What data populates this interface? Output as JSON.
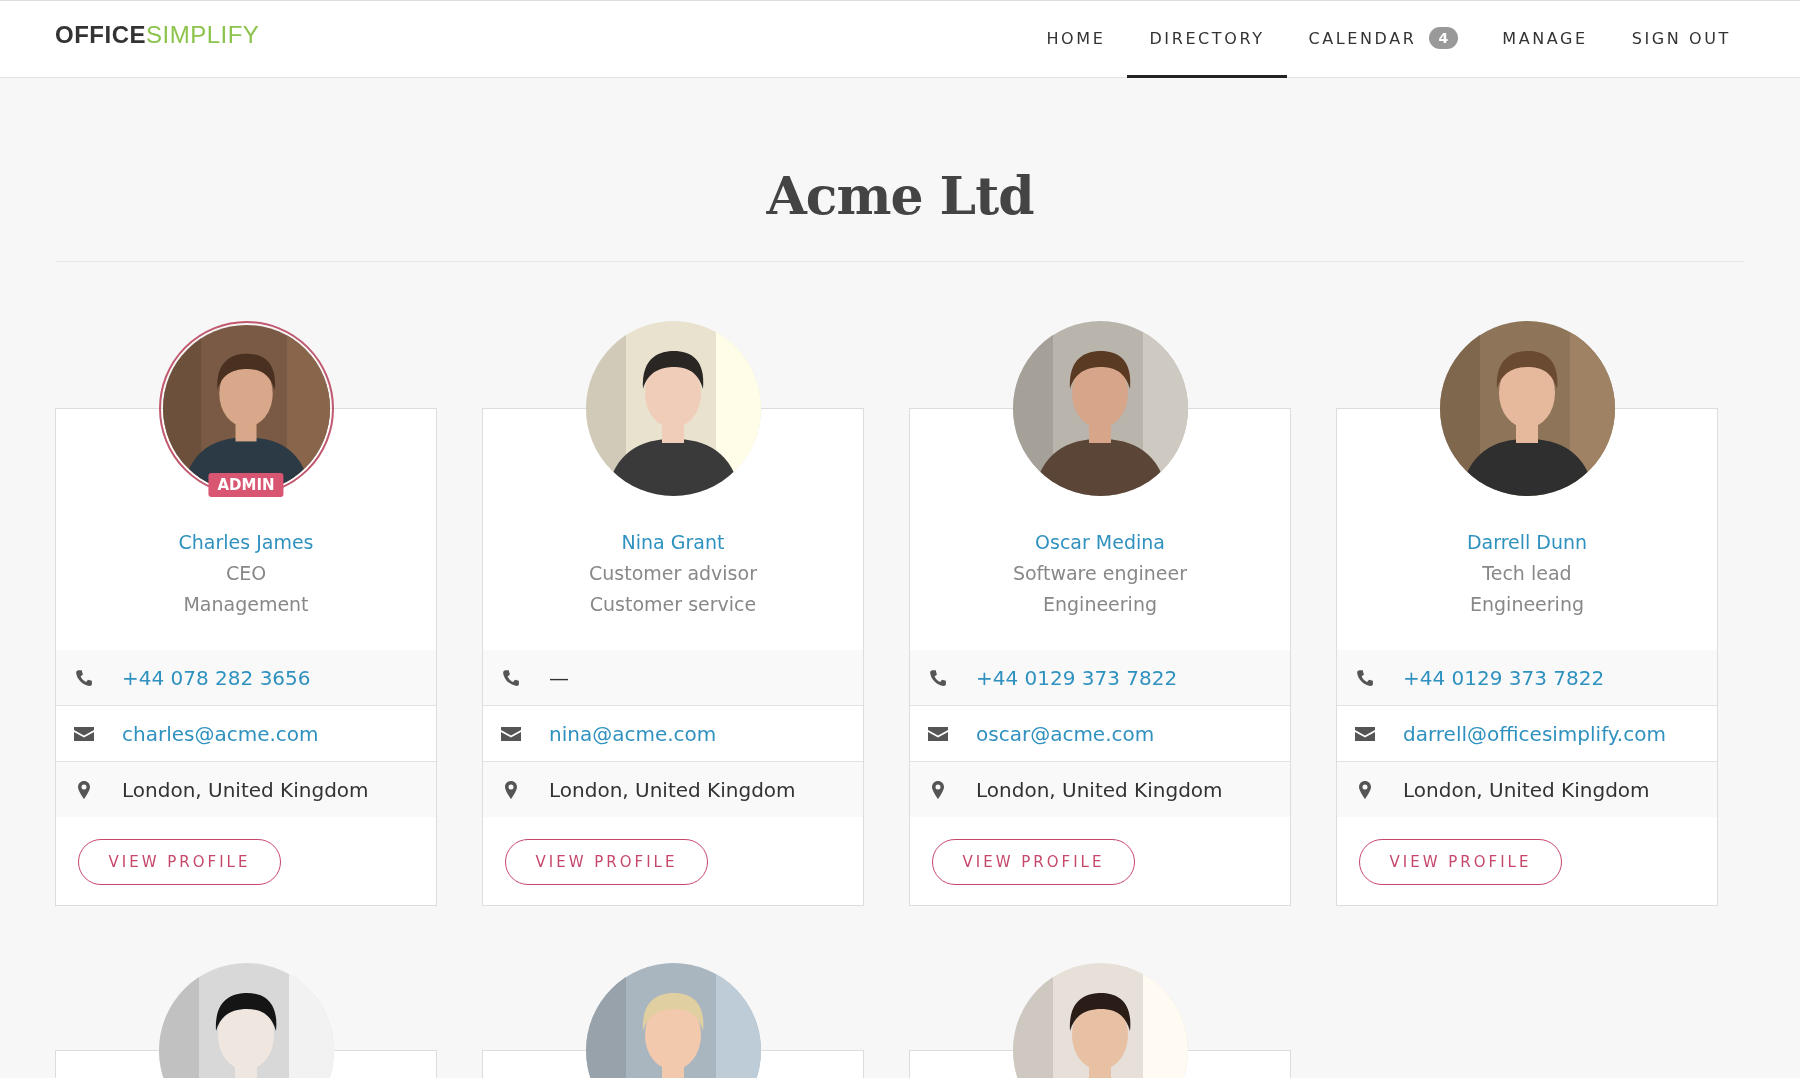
{
  "header": {
    "logo": "**OFFICE**SIMPLIFY",
    "nav": [
      {
        "label": "HOME",
        "selected": false
      },
      {
        "label": "DIRECTORY",
        "selected": true
      },
      {
        "label": "CALENDAR",
        "selected": false,
        "badge": "4"
      },
      {
        "label": "MANAGE",
        "selected": false
      },
      {
        "label": "SIGN OUT",
        "selected": false
      }
    ]
  },
  "title": "Acme Ltd",
  "people": [
    {
      "avatar": {
        "kind": "picture"
      },
      "admin": true,
      "badge": "ADMIN",
      "name": "Charles James",
      "role": "CEO",
      "department": "Management",
      "phone": "+44 078 282 3656",
      "phone_link": true,
      "email": "charles@acme.com",
      "location": "London, United Kingdom",
      "button": "VIEW PROFILE"
    },
    {
      "avatar": {
        "kind": "picture"
      },
      "admin": false,
      "name": "Nina Grant",
      "role": "Customer advisor",
      "department": "Customer service",
      "phone": "—",
      "phone_link": false,
      "email": "nina@acme.com",
      "location": "London, United Kingdom",
      "button": "VIEW PROFILE"
    },
    {
      "avatar": {
        "kind": "picture"
      },
      "admin": false,
      "name": "Oscar Medina",
      "role": "Software engineer",
      "department": "Engineering",
      "phone": "+44 0129 373 7822",
      "phone_link": true,
      "email": "oscar@acme.com",
      "location": "London, United Kingdom",
      "button": "VIEW PROFILE"
    },
    {
      "avatar": {
        "kind": "picture"
      },
      "admin": false,
      "name": "Darrell Dunn",
      "role": "Tech lead",
      "department": "Engineering",
      "phone": "+44 0129 373 7822",
      "phone_link": true,
      "email": "darrell@officesimplify.com",
      "location": "London, United Kingdom",
      "button": "VIEW PROFILE"
    },
    {
      "avatar": {
        "kind": "picture"
      }
    },
    {
      "avatar": {
        "kind": "picture"
      }
    },
    {
      "avatar": {
        "kind": "picture"
      }
    }
  ]
}
